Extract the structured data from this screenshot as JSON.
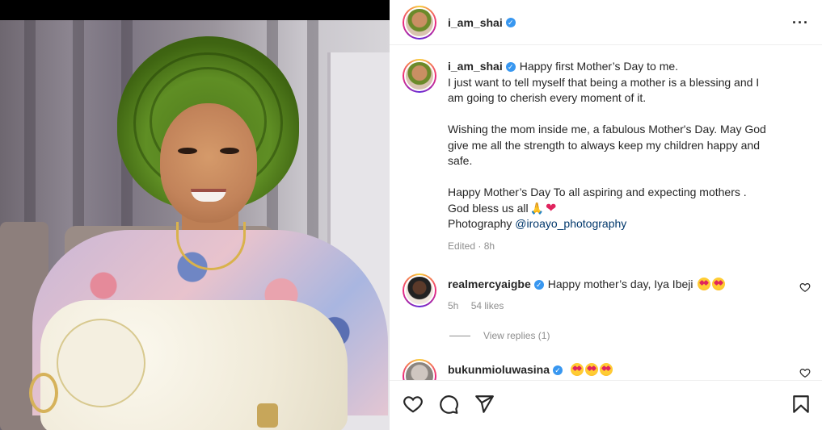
{
  "post": {
    "author": "i_am_shai",
    "more_icon": "more-horizontal-icon",
    "caption": {
      "first_line": "Happy first Mother’s Day to me.",
      "lines_p1": [
        "I just want to tell myself that being a mother is a blessing and I",
        "am going to cherish every moment of it."
      ],
      "lines_p2": [
        "Wishing the mom inside me, a fabulous Mother's Day. May God",
        "give me all the strength to always keep my children happy and",
        "safe."
      ],
      "line_p3a": "Happy Mother’s Day To all aspiring and expecting mothers .",
      "line_p3b": "God bless us all",
      "photography_label": "Photography",
      "photography_mention": "@iroayo_photography",
      "edited": "Edited · 8h"
    }
  },
  "comments": [
    {
      "username": "realmercyaigbe",
      "text": "Happy mother’s day, Iya Ibeji",
      "time": "5h",
      "likes": "54 likes",
      "view_replies": "View replies (1)"
    },
    {
      "username": "bukunmioluwasina",
      "text": ""
    }
  ],
  "actions": {
    "like_icon": "heart-icon",
    "comment_icon": "comment-icon",
    "share_icon": "share-icon",
    "save_icon": "bookmark-icon"
  },
  "colors": {
    "verified": "#3897f0",
    "mention": "#00376b",
    "meta": "#8e8e8e"
  }
}
